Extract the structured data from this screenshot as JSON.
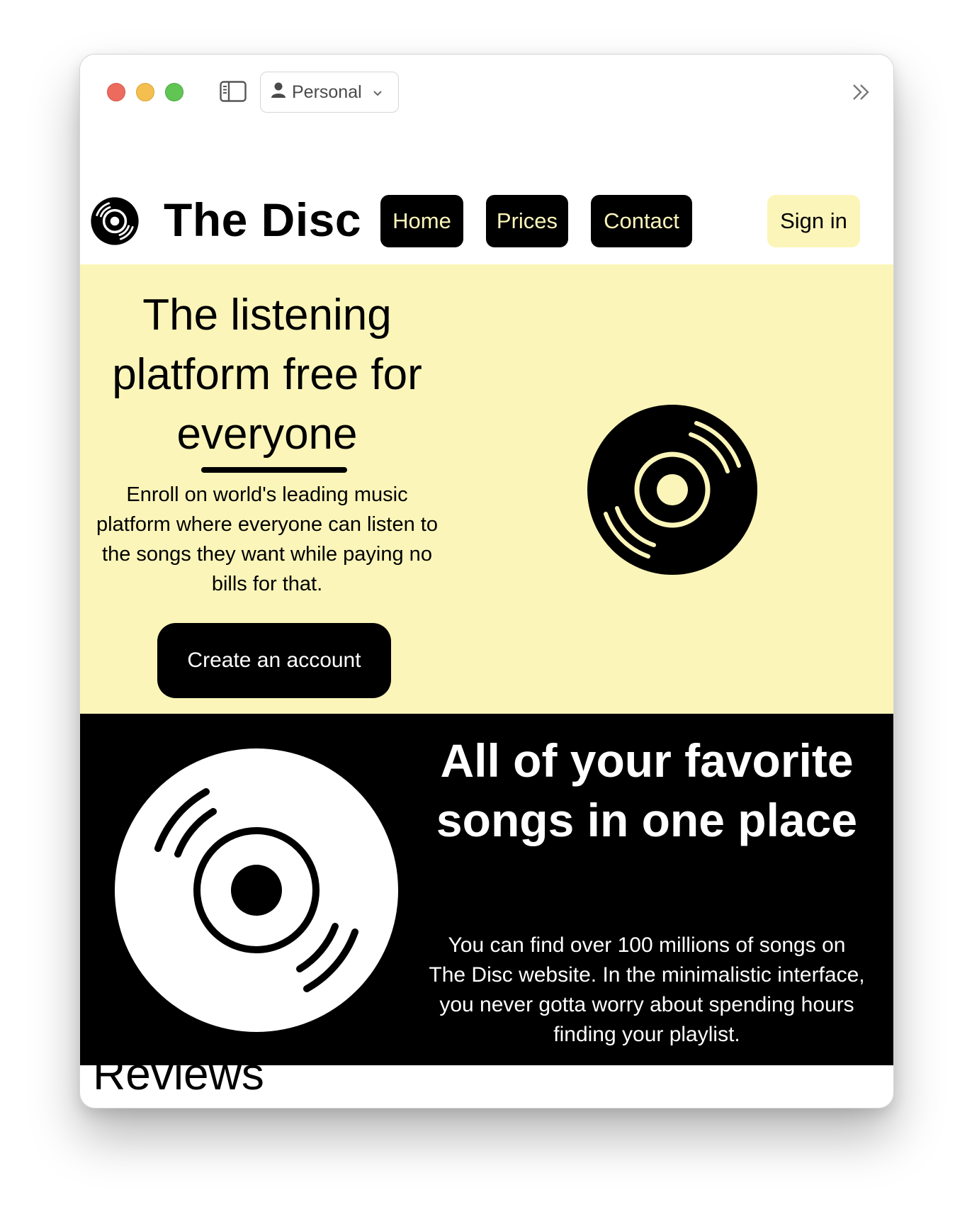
{
  "browser": {
    "profile_label": "Personal",
    "icons": [
      "sidebar-toggle-icon",
      "person-icon",
      "chevron-down-icon",
      "double-chevron-right-icon"
    ],
    "traffic_colors": {
      "close": "#ed6a5e",
      "minimize": "#f5bf4f",
      "zoom": "#61c554"
    }
  },
  "nav": {
    "brand": "The Disc",
    "items": [
      {
        "label": "Home"
      },
      {
        "label": "Prices"
      },
      {
        "label": "Contact"
      }
    ],
    "signin_label": "Sign in"
  },
  "hero": {
    "title": "The listening platform free for everyone",
    "text": "Enroll on world's leading music platform where everyone can listen to the songs they want while paying no bills for that.",
    "cta_label": "Create an account"
  },
  "feature": {
    "title": "All of your favorite songs in one place",
    "text": "You can find over 100 millions of songs on The Disc website. In the minimalistic interface, you never gotta worry about spending hours finding your playlist."
  },
  "reviews": {
    "title": "Reviews"
  },
  "colors": {
    "accent_yellow": "#fbf5b9",
    "black": "#000000",
    "white": "#ffffff"
  }
}
